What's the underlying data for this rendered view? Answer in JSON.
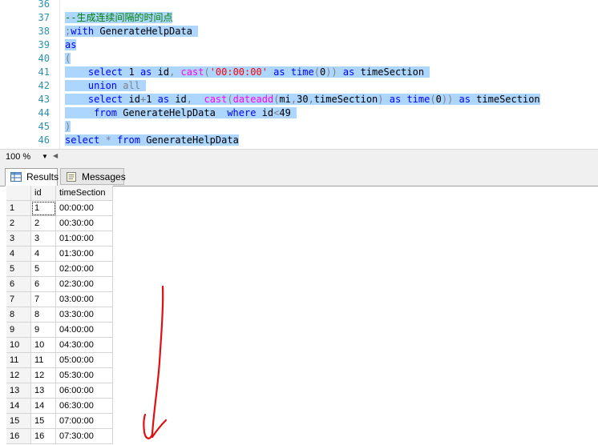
{
  "editor": {
    "line_numbers": [
      "36",
      "37",
      "38",
      "39",
      "40",
      "41",
      "42",
      "43",
      "44",
      "45",
      "46"
    ],
    "lines": [
      [],
      [
        {
          "c": "cm",
          "t": "--生成连续间隔的时间点"
        }
      ],
      [
        {
          "c": "op",
          "t": ";"
        },
        {
          "c": "kw",
          "t": "with"
        },
        {
          "c": "tx",
          "t": " GenerateHelpData "
        }
      ],
      [
        {
          "c": "kw",
          "t": "as"
        }
      ],
      [
        {
          "c": "op",
          "t": "("
        }
      ],
      [
        {
          "c": "tx",
          "t": "    "
        },
        {
          "c": "kw",
          "t": "select"
        },
        {
          "c": "tx",
          "t": " 1 "
        },
        {
          "c": "kw",
          "t": "as"
        },
        {
          "c": "tx",
          "t": " id"
        },
        {
          "c": "op",
          "t": ", "
        },
        {
          "c": "fn",
          "t": "cast"
        },
        {
          "c": "op",
          "t": "("
        },
        {
          "c": "str",
          "t": "'00:00:00'"
        },
        {
          "c": "tx",
          "t": " "
        },
        {
          "c": "kw",
          "t": "as"
        },
        {
          "c": "tx",
          "t": " "
        },
        {
          "c": "kw",
          "t": "time"
        },
        {
          "c": "op",
          "t": "("
        },
        {
          "c": "tx",
          "t": "0"
        },
        {
          "c": "op",
          "t": "))"
        },
        {
          "c": "tx",
          "t": " "
        },
        {
          "c": "kw",
          "t": "as"
        },
        {
          "c": "tx",
          "t": " timeSection "
        }
      ],
      [
        {
          "c": "tx",
          "t": "    "
        },
        {
          "c": "kw",
          "t": "union"
        },
        {
          "c": "tx",
          "t": " "
        },
        {
          "c": "op",
          "t": "all"
        },
        {
          "c": "tx",
          "t": " "
        }
      ],
      [
        {
          "c": "tx",
          "t": "    "
        },
        {
          "c": "kw",
          "t": "select"
        },
        {
          "c": "tx",
          "t": " id"
        },
        {
          "c": "op",
          "t": "+"
        },
        {
          "c": "tx",
          "t": "1 "
        },
        {
          "c": "kw",
          "t": "as"
        },
        {
          "c": "tx",
          "t": " id"
        },
        {
          "c": "op",
          "t": ","
        },
        {
          "c": "tx",
          "t": "  "
        },
        {
          "c": "fn",
          "t": "cast"
        },
        {
          "c": "op",
          "t": "("
        },
        {
          "c": "fn",
          "t": "dateadd"
        },
        {
          "c": "op",
          "t": "("
        },
        {
          "c": "tx",
          "t": "mi"
        },
        {
          "c": "op",
          "t": ","
        },
        {
          "c": "tx",
          "t": "30"
        },
        {
          "c": "op",
          "t": ","
        },
        {
          "c": "tx",
          "t": "timeSection"
        },
        {
          "c": "op",
          "t": ")"
        },
        {
          "c": "tx",
          "t": " "
        },
        {
          "c": "kw",
          "t": "as"
        },
        {
          "c": "tx",
          "t": " "
        },
        {
          "c": "kw",
          "t": "time"
        },
        {
          "c": "op",
          "t": "("
        },
        {
          "c": "tx",
          "t": "0"
        },
        {
          "c": "op",
          "t": "))"
        },
        {
          "c": "tx",
          "t": " "
        },
        {
          "c": "kw",
          "t": "as"
        },
        {
          "c": "tx",
          "t": " timeSection"
        }
      ],
      [
        {
          "c": "tx",
          "t": "     "
        },
        {
          "c": "kw",
          "t": "from"
        },
        {
          "c": "tx",
          "t": " GenerateHelpData  "
        },
        {
          "c": "kw",
          "t": "where"
        },
        {
          "c": "tx",
          "t": " id"
        },
        {
          "c": "op",
          "t": "<"
        },
        {
          "c": "tx",
          "t": "49 "
        }
      ],
      [
        {
          "c": "op",
          "t": ")"
        }
      ],
      [
        {
          "c": "kw",
          "t": "select"
        },
        {
          "c": "tx",
          "t": " "
        },
        {
          "c": "op",
          "t": "*"
        },
        {
          "c": "tx",
          "t": " "
        },
        {
          "c": "kw",
          "t": "from"
        },
        {
          "c": "tx",
          "t": " GenerateHelpData"
        }
      ]
    ]
  },
  "zoom": {
    "value": "100 %"
  },
  "tabs": {
    "results_label": "Results",
    "messages_label": "Messages"
  },
  "grid": {
    "columns": [
      "id",
      "timeSection"
    ],
    "rows": [
      [
        "1",
        "1",
        "00:00:00"
      ],
      [
        "2",
        "2",
        "00:30:00"
      ],
      [
        "3",
        "3",
        "01:00:00"
      ],
      [
        "4",
        "4",
        "01:30:00"
      ],
      [
        "5",
        "5",
        "02:00:00"
      ],
      [
        "6",
        "6",
        "02:30:00"
      ],
      [
        "7",
        "7",
        "03:00:00"
      ],
      [
        "8",
        "8",
        "03:30:00"
      ],
      [
        "9",
        "9",
        "04:00:00"
      ],
      [
        "10",
        "10",
        "04:30:00"
      ],
      [
        "11",
        "11",
        "05:00:00"
      ],
      [
        "12",
        "12",
        "05:30:00"
      ],
      [
        "13",
        "13",
        "06:00:00"
      ],
      [
        "14",
        "14",
        "06:30:00"
      ],
      [
        "15",
        "15",
        "07:00:00"
      ],
      [
        "16",
        "16",
        "07:30:00"
      ]
    ]
  },
  "annotation": {
    "color": "#e01010"
  }
}
